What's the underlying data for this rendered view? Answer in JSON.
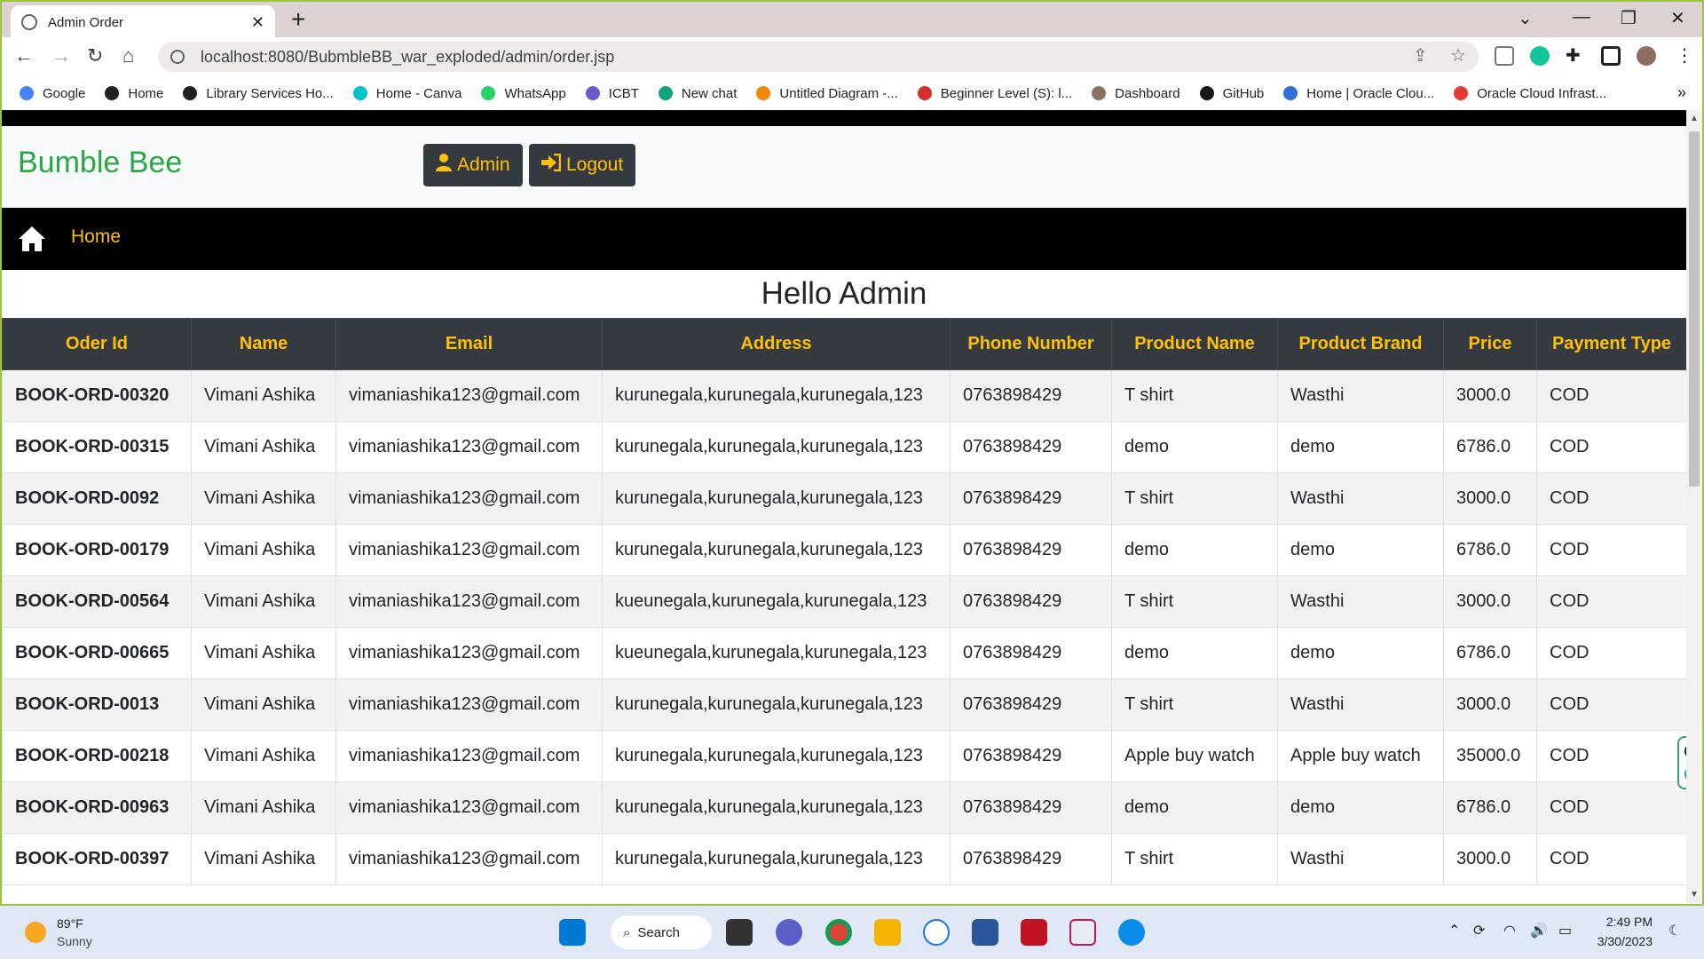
{
  "browser": {
    "tab_title": "Admin Order",
    "tab_close": "✕",
    "new_tab": "+",
    "url": "localhost:8080/BubmbleBB_war_exploded/admin/order.jsp",
    "bookmarks": [
      {
        "label": "Google",
        "icon": "google-icon",
        "color": "#4285f4"
      },
      {
        "label": "Home",
        "icon": "globe-icon",
        "color": "#202124"
      },
      {
        "label": "Library Services Ho...",
        "icon": "globe-icon",
        "color": "#202124"
      },
      {
        "label": "Home - Canva",
        "icon": "canva-icon",
        "color": "#00c4cc"
      },
      {
        "label": "WhatsApp",
        "icon": "whatsapp-icon",
        "color": "#25d366"
      },
      {
        "label": "ICBT",
        "icon": "icbt-icon",
        "color": "#6a5acd"
      },
      {
        "label": "New chat",
        "icon": "chatgpt-icon",
        "color": "#10a37f"
      },
      {
        "label": "Untitled Diagram -...",
        "icon": "drawio-icon",
        "color": "#f08705"
      },
      {
        "label": "Beginner Level (S): l...",
        "icon": "bookmark-red-icon",
        "color": "#d32f2f"
      },
      {
        "label": "Dashboard",
        "icon": "dashboard-icon",
        "color": "#8d6e63"
      },
      {
        "label": "GitHub",
        "icon": "github-icon",
        "color": "#181717"
      },
      {
        "label": "Home | Oracle Clou...",
        "icon": "cloud-icon",
        "color": "#2f6fd6"
      },
      {
        "label": "Oracle Cloud Infrast...",
        "icon": "oracle-icon",
        "color": "#e53935"
      }
    ],
    "bookmarks_more": "»"
  },
  "header": {
    "brand": "Bumble Bee",
    "admin_label": "Admin",
    "logout_label": "Logout"
  },
  "nav": {
    "home_label": "Home"
  },
  "greeting": "Hello Admin",
  "table": {
    "headers": [
      "Oder Id",
      "Name",
      "Email",
      "Address",
      "Phone Number",
      "Product Name",
      "Product Brand",
      "Price",
      "Payment Type"
    ],
    "rows": [
      [
        "BOOK-ORD-00320",
        "Vimani Ashika",
        "vimaniashika123@gmail.com",
        "kurunegala,kurunegala,kurunegala,123",
        "0763898429",
        "T shirt",
        "Wasthi",
        "3000.0",
        "COD"
      ],
      [
        "BOOK-ORD-00315",
        "Vimani Ashika",
        "vimaniashika123@gmail.com",
        "kurunegala,kurunegala,kurunegala,123",
        "0763898429",
        "demo",
        "demo",
        "6786.0",
        "COD"
      ],
      [
        "BOOK-ORD-0092",
        "Vimani Ashika",
        "vimaniashika123@gmail.com",
        "kurunegala,kurunegala,kurunegala,123",
        "0763898429",
        "T shirt",
        "Wasthi",
        "3000.0",
        "COD"
      ],
      [
        "BOOK-ORD-00179",
        "Vimani Ashika",
        "vimaniashika123@gmail.com",
        "kurunegala,kurunegala,kurunegala,123",
        "0763898429",
        "demo",
        "demo",
        "6786.0",
        "COD"
      ],
      [
        "BOOK-ORD-00564",
        "Vimani Ashika",
        "vimaniashika123@gmail.com",
        "kueunegala,kurunegala,kurunegala,123",
        "0763898429",
        "T shirt",
        "Wasthi",
        "3000.0",
        "COD"
      ],
      [
        "BOOK-ORD-00665",
        "Vimani Ashika",
        "vimaniashika123@gmail.com",
        "kueunegala,kurunegala,kurunegala,123",
        "0763898429",
        "demo",
        "demo",
        "6786.0",
        "COD"
      ],
      [
        "BOOK-ORD-0013",
        "Vimani Ashika",
        "vimaniashika123@gmail.com",
        "kurunegala,kurunegala,kurunegala,123",
        "0763898429",
        "T shirt",
        "Wasthi",
        "3000.0",
        "COD"
      ],
      [
        "BOOK-ORD-00218",
        "Vimani Ashika",
        "vimaniashika123@gmail.com",
        "kurunegala,kurunegala,kurunegala,123",
        "0763898429",
        "Apple buy watch",
        "Apple buy watch",
        "35000.0",
        "COD"
      ],
      [
        "BOOK-ORD-00963",
        "Vimani Ashika",
        "vimaniashika123@gmail.com",
        "kurunegala,kurunegala,kurunegala,123",
        "0763898429",
        "demo",
        "demo",
        "6786.0",
        "COD"
      ],
      [
        "BOOK-ORD-00397",
        "Vimani Ashika",
        "vimaniashika123@gmail.com",
        "kurunegala,kurunegala,kurunegala,123",
        "0763898429",
        "T shirt",
        "Wasthi",
        "3000.0",
        "COD"
      ]
    ]
  },
  "taskbar": {
    "temperature": "89°F",
    "condition": "Sunny",
    "search_label": "Search",
    "time": "2:49 PM",
    "date": "3/30/2023"
  },
  "colors": {
    "brand": "#28a745",
    "accent": "#ffc107",
    "dark": "#343a40",
    "frame": "#9bc53d"
  }
}
